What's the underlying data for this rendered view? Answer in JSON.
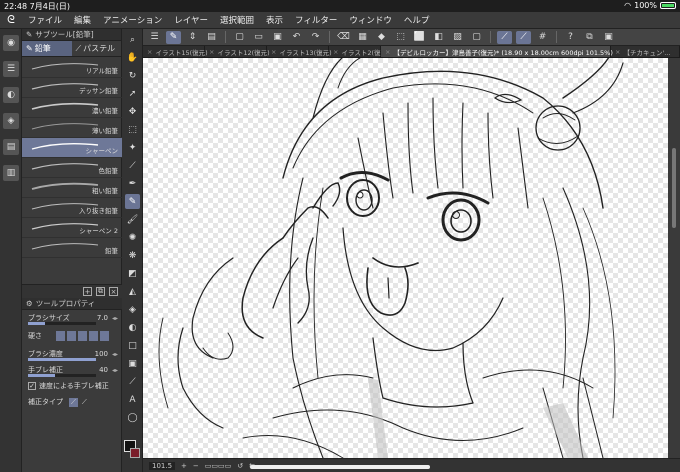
{
  "status": {
    "time": "22:48",
    "date": "7月4日(日)",
    "battery": "100%"
  },
  "menu": [
    "ファイル",
    "編集",
    "アニメーション",
    "レイヤー",
    "選択範囲",
    "表示",
    "フィルター",
    "ウィンドウ",
    "ヘルプ"
  ],
  "subtool": {
    "header": "サブツール[鉛筆]",
    "tabs": [
      {
        "label": "鉛筆"
      },
      {
        "label": "パステル"
      }
    ],
    "brushes": [
      {
        "label": "リアル鉛筆"
      },
      {
        "label": "デッサン鉛筆"
      },
      {
        "label": "濃い鉛筆"
      },
      {
        "label": "薄い鉛筆"
      },
      {
        "label": "シャーペン"
      },
      {
        "label": "色鉛筆"
      },
      {
        "label": "粗い鉛筆"
      },
      {
        "label": "入り抜き鉛筆"
      },
      {
        "label": "シャーペン 2"
      },
      {
        "label": "鉛筆"
      }
    ],
    "selected_index": 4
  },
  "toolprop": {
    "header": "ツールプロパティ",
    "brush_size_label": "ブラシサイズ",
    "brush_size_value": "7.0",
    "hardness_label": "硬さ",
    "density_label": "ブラシ濃度",
    "density_value": "100",
    "stabilizer_label": "手ブレ補正",
    "stabilizer_value": "40",
    "speed_label": "速度による手ブレ補正",
    "correction_label": "補正タイプ"
  },
  "tabs": [
    {
      "label": "イラスト15(復元)"
    },
    {
      "label": "イラスト12(復元)"
    },
    {
      "label": "イラスト13(復元)"
    },
    {
      "label": "イラスト2(復元)"
    },
    {
      "label": "【デビルロッカー】津島善子(復元)* (18.90 x 18.00cm 600dpi 101.5%)"
    },
    {
      "label": "【チカキュン'..."
    }
  ],
  "bottom": {
    "zoom": "101.5"
  },
  "colors": {
    "accent": "#6e7898",
    "panel": "#3b3b3b",
    "main_color": "#111111",
    "sub_color": "#7a1d2a"
  }
}
